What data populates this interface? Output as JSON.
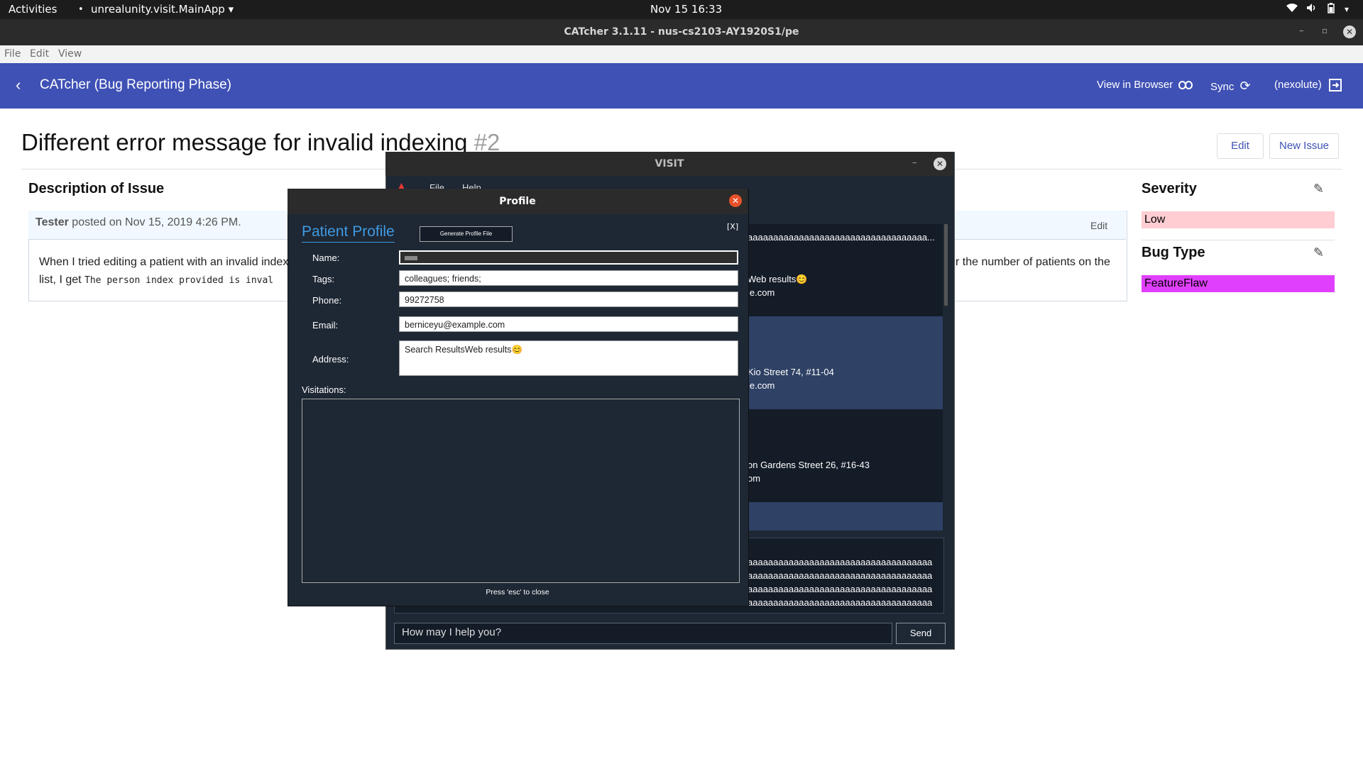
{
  "topbar": {
    "activities": "Activities",
    "app_name": "unrealunity.visit.MainApp",
    "clock": "Nov 15  16:33"
  },
  "window": {
    "title": "CATcher 3.1.11 - nus-cs2103-AY1920S1/pe",
    "menu": [
      "File",
      "Edit",
      "View"
    ]
  },
  "header": {
    "title": "CATcher  (Bug Reporting Phase)",
    "view_in_browser": "View in Browser",
    "sync": "Sync",
    "user": "(nexolute)"
  },
  "issue": {
    "title": "Different error message for invalid indexing",
    "number": "#2",
    "edit_label": "Edit",
    "new_issue_label": "New Issue",
    "description_heading": "Description of Issue",
    "author": "Tester",
    "posted": " posted on Nov 15, 2019 4:26 PM.",
    "comment_edit": "Edit",
    "body_line1_start": "When I tried editing a patient with an invalid index",
    "body_line1_end": "r the number of patients on the",
    "body_line2_start": "list, I get ",
    "body_code": "The person index provided is inval"
  },
  "sidebar": {
    "severity_heading": "Severity",
    "severity_value": "Low",
    "bugtype_heading": "Bug Type",
    "bugtype_value": "FeatureFlaw",
    "colors": {
      "low": "#ffcdd2",
      "featureflaw": "#e040fb"
    }
  },
  "visit": {
    "title": "VISIT",
    "menu_file": "File",
    "menu_help": "Help",
    "list_text_1": "aaaaaaaaaaaaaaaaaaaaaaaaaaaaaaaaaaa...",
    "list_text_2": "Web results😊",
    "list_text_3": "le.com",
    "list_text_4": "Kio Street 74, #11-04",
    "list_text_5": "le.com",
    "list_text_6": "on Gardens Street 26, #16-43",
    "list_text_7": "om",
    "output_lines": [
      "aaaaaaaaaaaaaaaaaaaaaaaaaaaaaaaaaaaa",
      "aaaaaaaaaaaaaaaaaaaaaaaaaaaaaaaaaaaa",
      "aaaaaaaaaaaaaaaaaaaaaaaaaaaaaaaaaaaa",
      "aaaaaaaaaaaaaaaaaaaaaaaaaaaaaaaaaaaa"
    ],
    "command_placeholder": "How may I help you?",
    "send_label": "Send"
  },
  "profile": {
    "title": "Profile",
    "heading": "Patient Profile",
    "generate_label": "Generate Profile File",
    "close_label": "[X]",
    "name_label": "Name:",
    "tags_label": "Tags:",
    "tags_value": "colleagues; friends;",
    "phone_label": "Phone:",
    "phone_value": "99272758",
    "email_label": "Email:",
    "email_value": "berniceyu@example.com",
    "address_label": "Address:",
    "address_value": "Search ResultsWeb results😊",
    "visitations_label": "Visitations:",
    "footer": "Press 'esc' to close"
  }
}
